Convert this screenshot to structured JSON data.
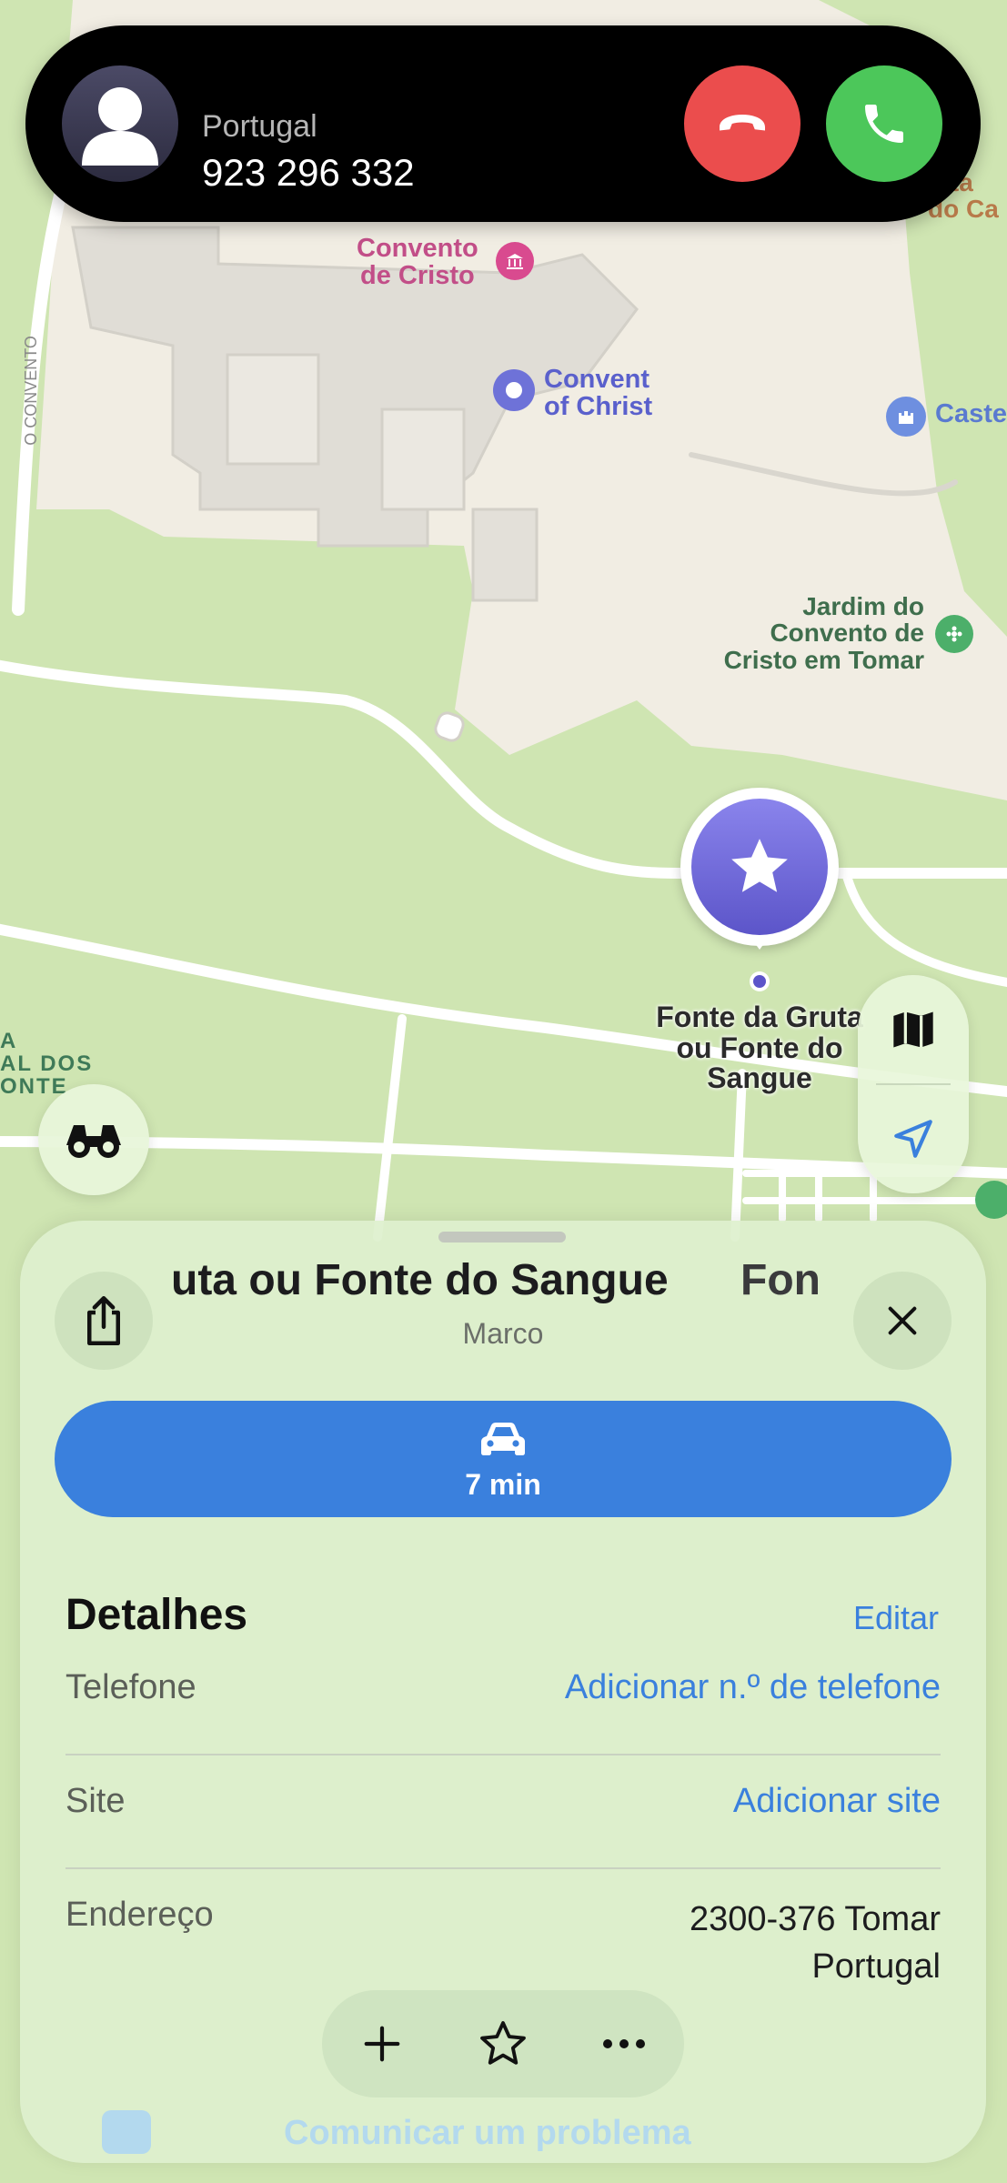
{
  "call": {
    "country": "Portugal",
    "number": "923 296 332",
    "decline_icon": "phone-down-icon",
    "accept_icon": "phone-icon"
  },
  "map": {
    "labels": {
      "convento_cristo": "Convento\nde Cristo",
      "convent_christ": "Convent\nof Christ",
      "castle": "Caste",
      "jardim": "Jardim do\nConvento de\nCristo em Tomar",
      "street": "O CONVENTO",
      "cafe": "feta\ndo Ca",
      "left_area": "A\nAL DOS\nONTE",
      "pin": "Fonte da Gruta\nou Fonte do\nSangue"
    },
    "pin_icon": "star-icon",
    "colors": {
      "park": "#cfe5b2",
      "ground": "#f1ede3",
      "road": "#ffffff",
      "pin": "#6a62d6"
    }
  },
  "controls": {
    "map_mode_icon": "map-icon",
    "location_icon": "location-arrow-icon",
    "lookaround_icon": "binoculars-icon"
  },
  "sheet": {
    "title_main": "uta ou Fonte do Sangue",
    "title_next": "Fon",
    "subtitle": "Marco",
    "route_time": "7 min",
    "details_heading": "Detalhes",
    "edit_label": "Editar",
    "rows": [
      {
        "label": "Telefone",
        "value": "Adicionar n.º de telefone"
      },
      {
        "label": "Site",
        "value": "Adicionar site"
      },
      {
        "label": "Endereço",
        "value": "2300-376 Tomar\nPortugal"
      }
    ],
    "report_label": "Comunicar um problema",
    "accent": "#3a80dd"
  }
}
